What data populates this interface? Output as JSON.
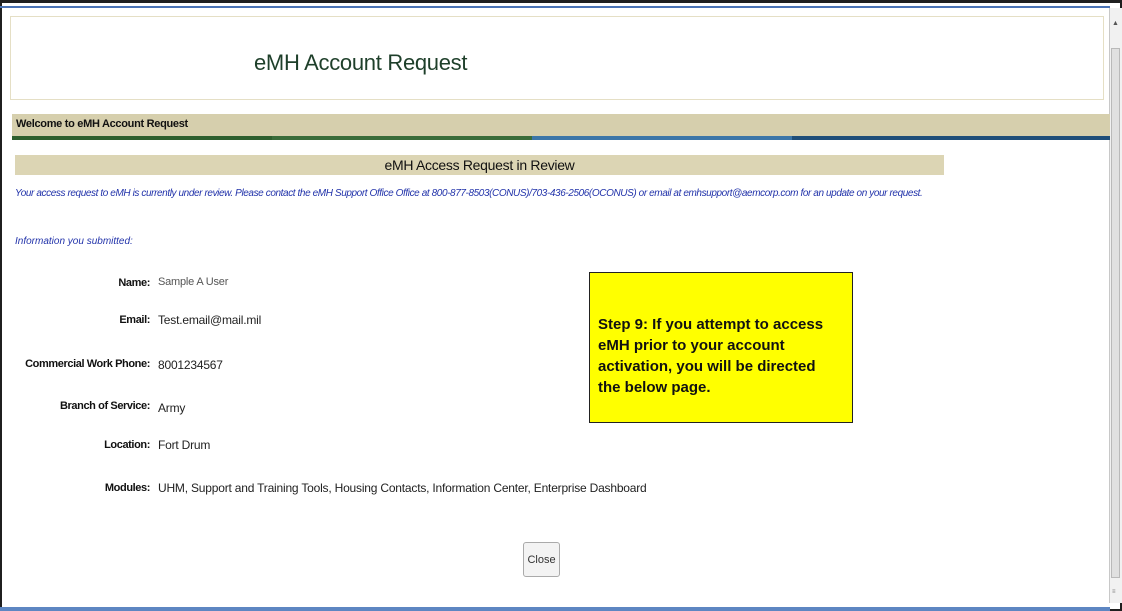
{
  "header": {
    "title": "eMH Account Request"
  },
  "welcome_bar": {
    "text": "Welcome to eMH Account Request"
  },
  "review": {
    "title": "eMH Access Request in Review",
    "notice": "Your access request to eMH is currently under review. Please contact the eMH Support Office Office at 800-877-8503(CONUS)/703-436-2506(OCONUS) or email at emhsupport@aemcorp.com for an update on your request.",
    "info_label": "Information you submitted:"
  },
  "fields": [
    {
      "label": "Name:",
      "value": "Sample A User"
    },
    {
      "label": "Email:",
      "value": "Test.email@mail.mil"
    },
    {
      "label": "Commercial Work Phone:",
      "value": "8001234567"
    },
    {
      "label": "Branch of Service:",
      "value": "Army"
    },
    {
      "label": "Location:",
      "value": "Fort Drum"
    },
    {
      "label": "Modules:",
      "value": "UHM, Support and Training Tools, Housing Contacts, Information Center, Enterprise Dashboard"
    }
  ],
  "close_button": "Close",
  "callout": {
    "text": "Step 9:  If you attempt to access eMH prior to your account activation, you will be directed the below page."
  },
  "colors": {
    "accent_bar": "#d6cfad",
    "callout_bg": "#ffff00",
    "notice_text": "#2233aa",
    "stripes": [
      "#2e5f2e",
      "#3a6c3a",
      "#3c76a8",
      "#1f4e79"
    ]
  }
}
